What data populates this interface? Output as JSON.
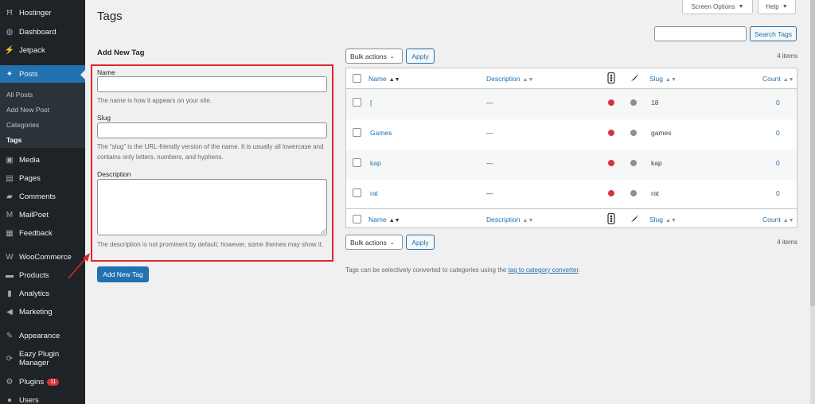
{
  "sidebar": {
    "items": [
      {
        "label": "Hostinger",
        "icon": "hostinger-logo-icon",
        "glyph": "Ħ"
      },
      {
        "label": "Dashboard",
        "icon": "dashboard-icon",
        "glyph": "◍"
      },
      {
        "label": "Jetpack",
        "icon": "jetpack-icon",
        "glyph": "⚡"
      },
      {
        "label": "Posts",
        "icon": "pin-icon",
        "glyph": "📌"
      },
      {
        "label": "Media",
        "icon": "media-icon",
        "glyph": "▣"
      },
      {
        "label": "Pages",
        "icon": "pages-icon",
        "glyph": "▤"
      },
      {
        "label": "Comments",
        "icon": "comments-icon",
        "glyph": "▰"
      },
      {
        "label": "MailPoet",
        "icon": "mailpoet-icon",
        "glyph": "M"
      },
      {
        "label": "Feedback",
        "icon": "feedback-icon",
        "glyph": "▦"
      },
      {
        "label": "WooCommerce",
        "icon": "woocommerce-icon",
        "glyph": "W"
      },
      {
        "label": "Products",
        "icon": "products-icon",
        "glyph": "▬"
      },
      {
        "label": "Analytics",
        "icon": "analytics-icon",
        "glyph": "▮"
      },
      {
        "label": "Marketing",
        "icon": "marketing-icon",
        "glyph": "◀"
      },
      {
        "label": "Appearance",
        "icon": "appearance-icon",
        "glyph": "✎"
      },
      {
        "label": "Eazy Plugin Manager",
        "icon": "plugin-manager-icon",
        "glyph": "⟳"
      },
      {
        "label": "Plugins",
        "icon": "plugins-icon",
        "glyph": "⚙"
      },
      {
        "label": "Users",
        "icon": "users-icon",
        "glyph": "●"
      }
    ],
    "submenu": [
      "All Posts",
      "Add New Post",
      "Categories",
      "Tags"
    ],
    "plugins_badge": "11"
  },
  "header": {
    "title": "Tags",
    "screen_options": "Screen Options",
    "help": "Help",
    "search_button": "Search Tags",
    "search_value": ""
  },
  "form": {
    "title": "Add New Tag",
    "name_label": "Name",
    "name_value": "",
    "name_help": "The name is how it appears on your site.",
    "slug_label": "Slug",
    "slug_value": "",
    "slug_help": "The “slug” is the URL-friendly version of the name. It is usually all lowercase and contains only letters, numbers, and hyphens.",
    "description_label": "Description",
    "description_value": "",
    "description_help": "The description is not prominent by default; however, some themes may show it.",
    "submit": "Add New Tag"
  },
  "table": {
    "bulk_actions": "Bulk actions",
    "apply": "Apply",
    "items_count": "4 items",
    "columns": {
      "name": "Name",
      "description": "Description",
      "slug": "Slug",
      "count": "Count"
    },
    "rows": [
      {
        "name": "[",
        "description": "—",
        "slug": "18",
        "count": "0"
      },
      {
        "name": "Games",
        "description": "—",
        "slug": "games",
        "count": "0"
      },
      {
        "name": "kap",
        "description": "—",
        "slug": "kap",
        "count": "0"
      },
      {
        "name": "rat",
        "description": "—",
        "slug": "rat",
        "count": "0"
      }
    ],
    "status_colors": {
      "red": "#d63638",
      "gray": "#8c8f94"
    }
  },
  "footnote": {
    "text": "Tags can be selectively converted to categories using the",
    "link": "tag to category converter",
    "end": "."
  },
  "colors": {
    "accent": "#2271b1",
    "highlight_box": "#e0242b",
    "sidebar_bg": "#1d2327"
  }
}
